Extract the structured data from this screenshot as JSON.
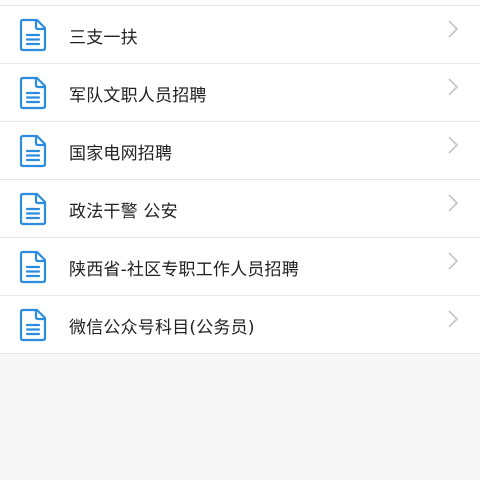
{
  "colors": {
    "icon": "#2b8ce0",
    "chevron": "#c4c4c4",
    "text": "#222222",
    "divider": "#e6e6e6",
    "background": "#f7f7f7"
  },
  "items": [
    {
      "label": "三支一扶",
      "icon": "document-icon"
    },
    {
      "label": "军队文职人员招聘",
      "icon": "document-icon"
    },
    {
      "label": "国家电网招聘",
      "icon": "document-icon"
    },
    {
      "label": "政法干警 公安",
      "icon": "document-icon"
    },
    {
      "label": "陕西省-社区专职工作人员招聘",
      "icon": "document-icon"
    },
    {
      "label": "微信公众号科目(公务员)",
      "icon": "document-icon"
    }
  ]
}
